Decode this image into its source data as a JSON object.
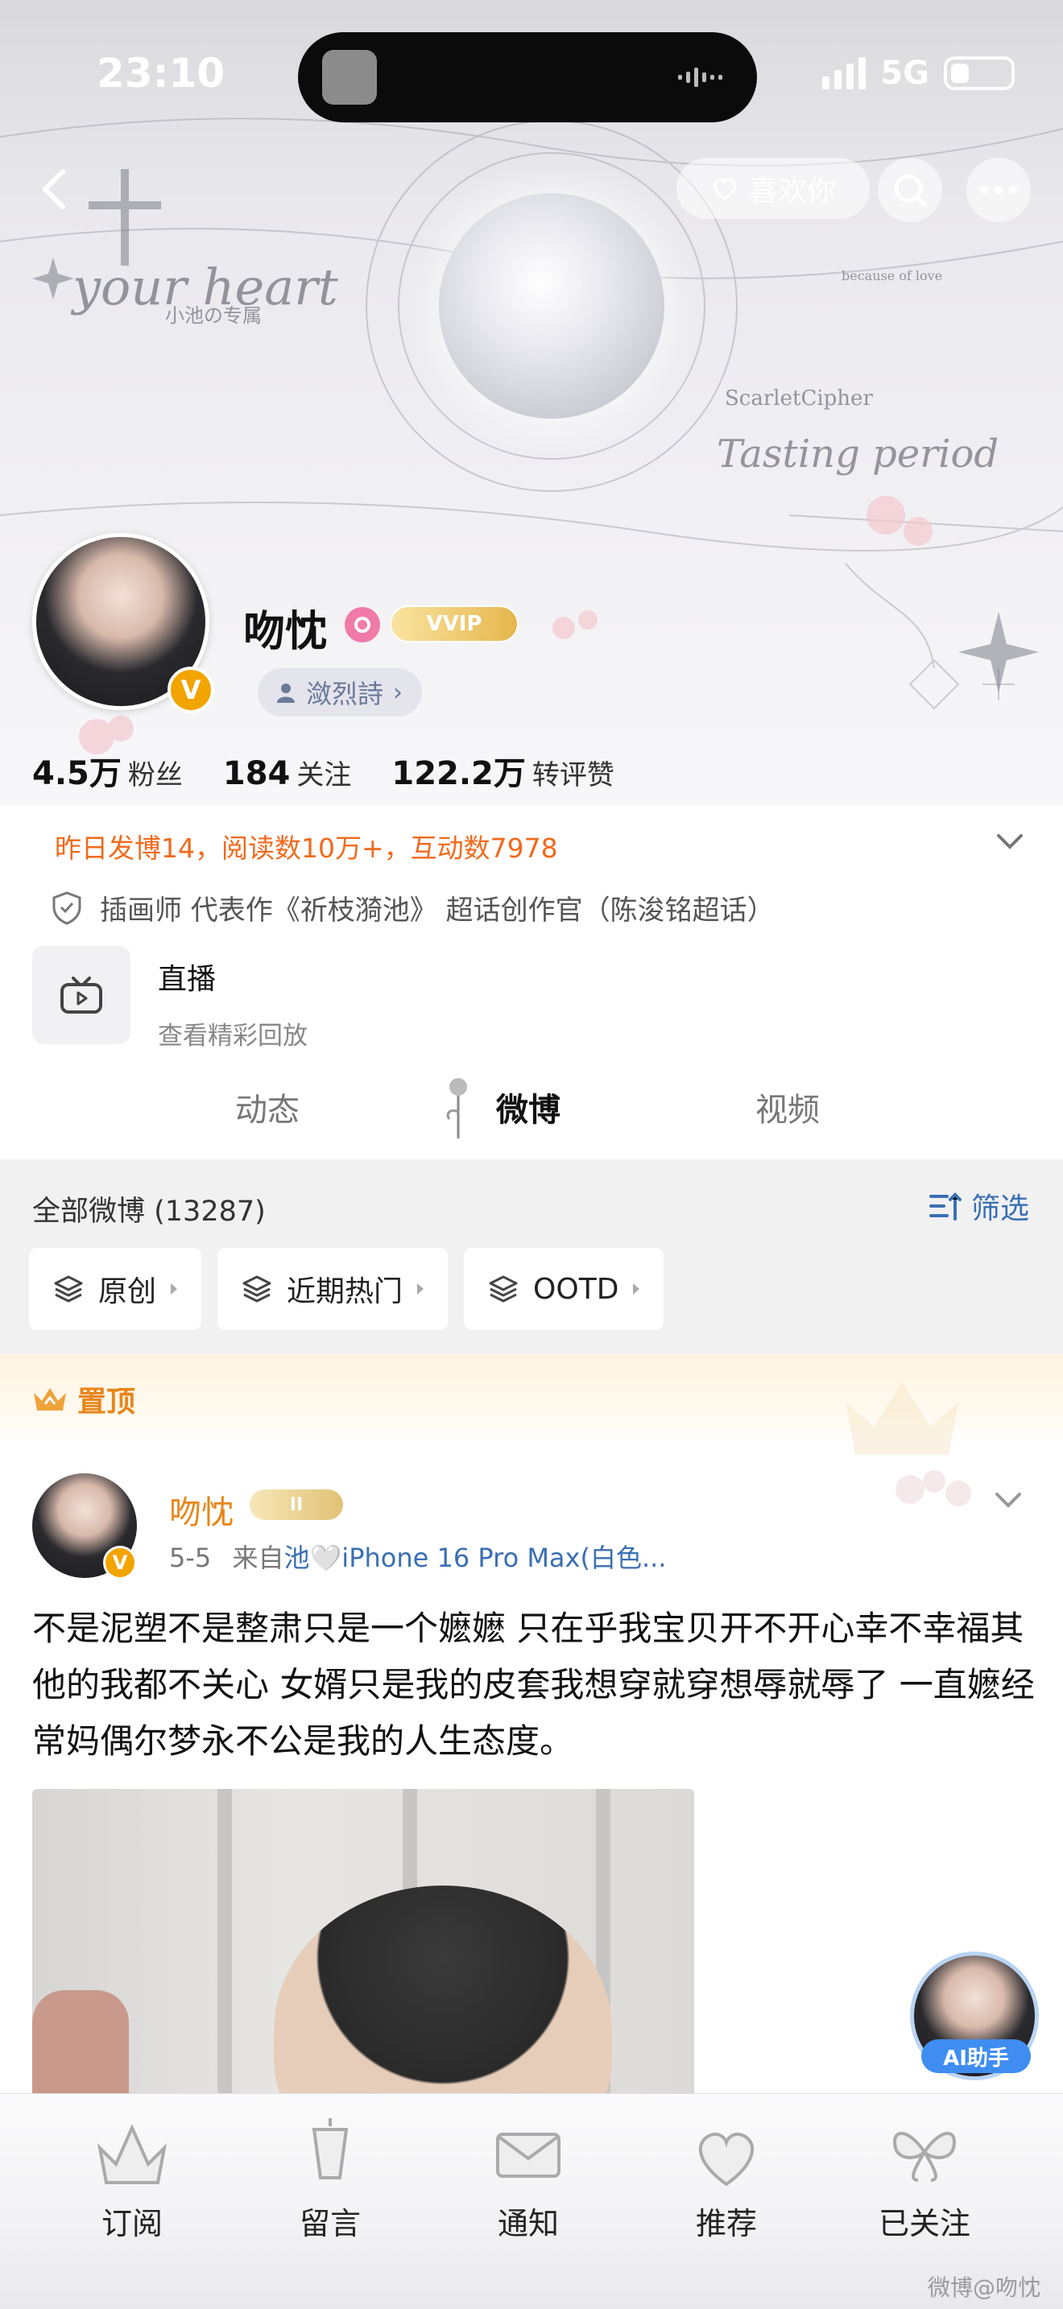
{
  "status_bar": {
    "time": "23:10",
    "network": "5G"
  },
  "header": {
    "like_label": "喜欢你"
  },
  "banner_text": {
    "t1": "your heart",
    "t2": "小池の专属",
    "t3": "ScarletCipher",
    "t4": "Tasting period",
    "t5": "because of love"
  },
  "profile": {
    "name": "吻忱",
    "vip": "VVIP",
    "group": "潋烈詩",
    "verified": "V",
    "stats": [
      {
        "value": "4.5万",
        "label": "粉丝"
      },
      {
        "value": "184",
        "label": "关注"
      },
      {
        "value": "122.2万",
        "label": "转评赞"
      }
    ],
    "daily": "昨日发博14，阅读数10万+，互动数7978",
    "cert": "插画师 代表作《祈枝漪池》 超话创作官（陈浚铭超话）"
  },
  "live": {
    "title": "直播",
    "subtitle": "查看精彩回放"
  },
  "tabs": [
    {
      "label": "动态"
    },
    {
      "label": "微博"
    },
    {
      "label": "视频"
    }
  ],
  "filter": {
    "all": "全部微博 (13287)",
    "screen": "筛选",
    "chips": [
      {
        "label": "原创"
      },
      {
        "label": "近期热门"
      },
      {
        "label": "OOTD"
      }
    ]
  },
  "pinned": {
    "label": "置顶",
    "author": "吻忱",
    "badge": "II",
    "date": "5-5",
    "source_prefix": "来自",
    "source": "池🤍iPhone 16 Pro Max(白色...",
    "text": "不是泥塑不是整肃只是一个嬷嬷 只在乎我宝贝开不开心幸不幸福其他的我都不关心 女婿只是我的皮套我想穿就穿想辱就辱了 一直嬷经常妈偶尔梦永不公是我的人生态度。"
  },
  "ai_helper": {
    "label": "AI助手"
  },
  "bottom_nav": [
    {
      "label": "订阅"
    },
    {
      "label": "留言"
    },
    {
      "label": "通知"
    },
    {
      "label": "推荐"
    },
    {
      "label": "已关注"
    }
  ],
  "watermark": "微博@吻忱",
  "colors": {
    "accent_orange": "#f06a1d",
    "link_blue": "#3a6fb4",
    "pinned_orange": "#e8861a",
    "ai_blue": "#3f8df0"
  }
}
